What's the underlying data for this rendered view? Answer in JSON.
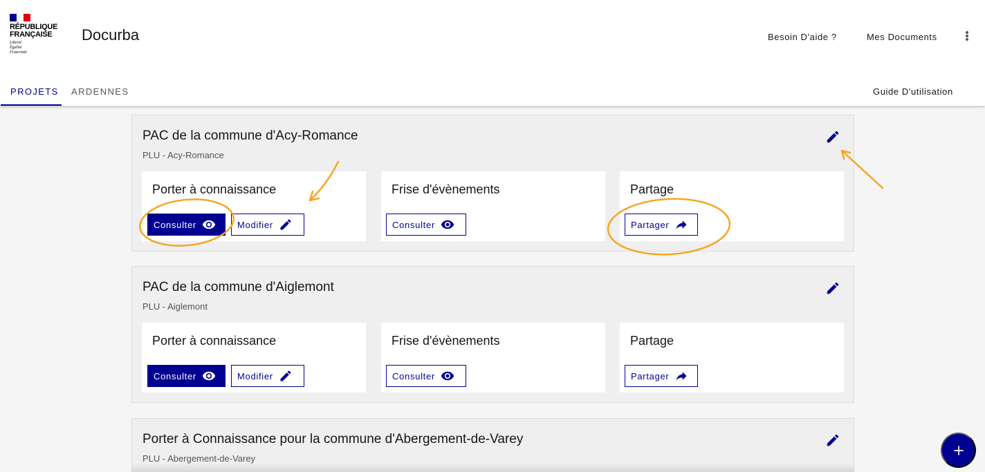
{
  "header": {
    "logo_line1": "République",
    "logo_line2": "Française",
    "logo_motto": [
      "Liberté",
      "Égalité",
      "Fraternité"
    ],
    "app_title": "Docurba",
    "help_link": "Besoin D'aide ?",
    "docs_link": "Mes Documents",
    "menu_icon": "kebab-menu-icon"
  },
  "tabs": [
    {
      "label": "PROJETS",
      "active": true
    },
    {
      "label": "ARDENNES",
      "active": false
    }
  ],
  "guide_link": "Guide D'utilisation",
  "projects": [
    {
      "title": "PAC de la commune d'Acy-Romance",
      "subtitle": "PLU - Acy-Romance",
      "boxes": {
        "pac": {
          "title": "Porter à connaissance",
          "consult": "Consulter",
          "modify": "Modifier"
        },
        "frise": {
          "title": "Frise d'évènements",
          "consult": "Consulter"
        },
        "partage": {
          "title": "Partage",
          "share": "Partager"
        }
      }
    },
    {
      "title": "PAC de la commune d'Aiglemont",
      "subtitle": "PLU - Aiglemont",
      "boxes": {
        "pac": {
          "title": "Porter à connaissance",
          "consult": "Consulter",
          "modify": "Modifier"
        },
        "frise": {
          "title": "Frise d'évènements",
          "consult": "Consulter"
        },
        "partage": {
          "title": "Partage",
          "share": "Partager"
        }
      }
    },
    {
      "title": "Porter à Connaissance pour la commune d'Abergement-de-Varey",
      "subtitle": "PLU - Abergement-de-Varey"
    }
  ],
  "icons": {
    "edit": "pencil-icon",
    "consult": "eye-icon",
    "share": "share-arrow-icon",
    "fab": "plus-icon"
  },
  "colors": {
    "primary": "#000091",
    "annotation": "#f5a623",
    "background": "#f5f5f5",
    "card": "#efefef"
  }
}
